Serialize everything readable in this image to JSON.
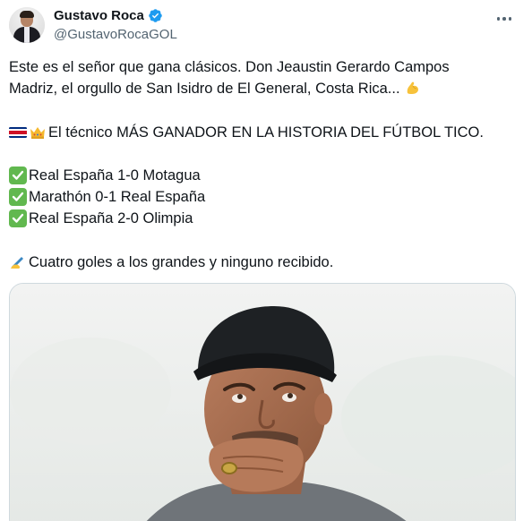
{
  "author": {
    "name": "Gustavo Roca",
    "handle": "@GustavoRocaGOL",
    "verified": true,
    "avatar_icon": "profile-photo"
  },
  "menu": {
    "icon": "more-dots-icon"
  },
  "tweet": {
    "line1": "Este es el señor que gana clásicos. Don Jeaustin Gerardo Campos",
    "line2": "Madriz, el orgullo de San Isidro de El General, Costa Rica...",
    "line3": "El técnico MÁS GANADOR EN LA HISTORIA DEL FÚTBOL TICO.",
    "results": [
      "Real España 1-0 Motagua",
      "Marathón 0-1 Real España",
      "Real España 2-0 Olimpia"
    ],
    "line7": "Cuatro goles a los grandes y ninguno recibido."
  },
  "emojis": {
    "flexed_biceps": "flexed-biceps",
    "costa_rica_flag": "flag-costa-rica",
    "crown": "crown",
    "check": "white-check-mark",
    "writing_hand": "writing-hand"
  },
  "colors": {
    "text": "#0f1419",
    "secondary": "#536471",
    "verified": "#1d9bf0",
    "check_green": "#61b84f"
  },
  "media": {
    "description_icon": "photo-man-looking-up-cap"
  }
}
